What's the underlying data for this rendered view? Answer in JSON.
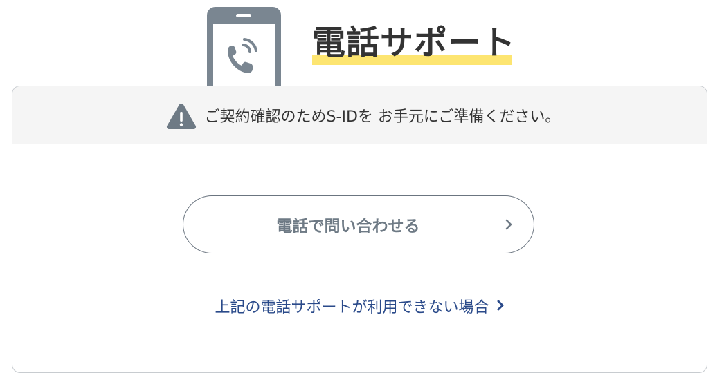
{
  "header": {
    "title": "電話サポート",
    "icon": "phone-call-icon"
  },
  "notice": {
    "icon": "warning-icon",
    "text": "ご契約確認のためS-IDを お手元にご準備ください。"
  },
  "call_button": {
    "label": "電話で問い合わせる",
    "icon": "chevron-right-icon"
  },
  "alt_link": {
    "label": "上記の電話サポートが利用できない場合",
    "icon": "chevron-right-icon"
  },
  "colors": {
    "title_highlight": "#fde571",
    "icon_gray": "#7a8691",
    "link_blue": "#2a4a8a",
    "notice_bg": "#f5f5f5"
  }
}
